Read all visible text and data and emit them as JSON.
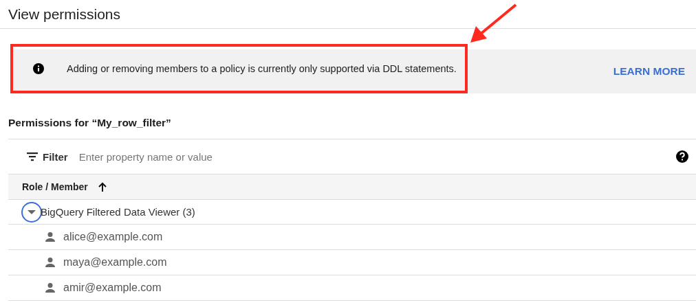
{
  "window": {
    "title": "View permissions"
  },
  "notice": {
    "text": "Adding or removing members to a policy is currently only supported via DDL statements.",
    "link": "LEARN MORE",
    "highlighted": true
  },
  "section_title": "Permissions for “My_row_filter”",
  "filter": {
    "label": "Filter",
    "placeholder": "Enter property name or value"
  },
  "table": {
    "column": "Role / Member",
    "sort_ascending": true,
    "groups": [
      {
        "name": "BigQuery Filtered Data Viewer (3)",
        "expanded": true,
        "highlighted": true,
        "children": [
          {
            "name": "alice@example.com"
          },
          {
            "name": "maya@example.com"
          },
          {
            "name": "amir@example.com"
          }
        ]
      }
    ]
  }
}
